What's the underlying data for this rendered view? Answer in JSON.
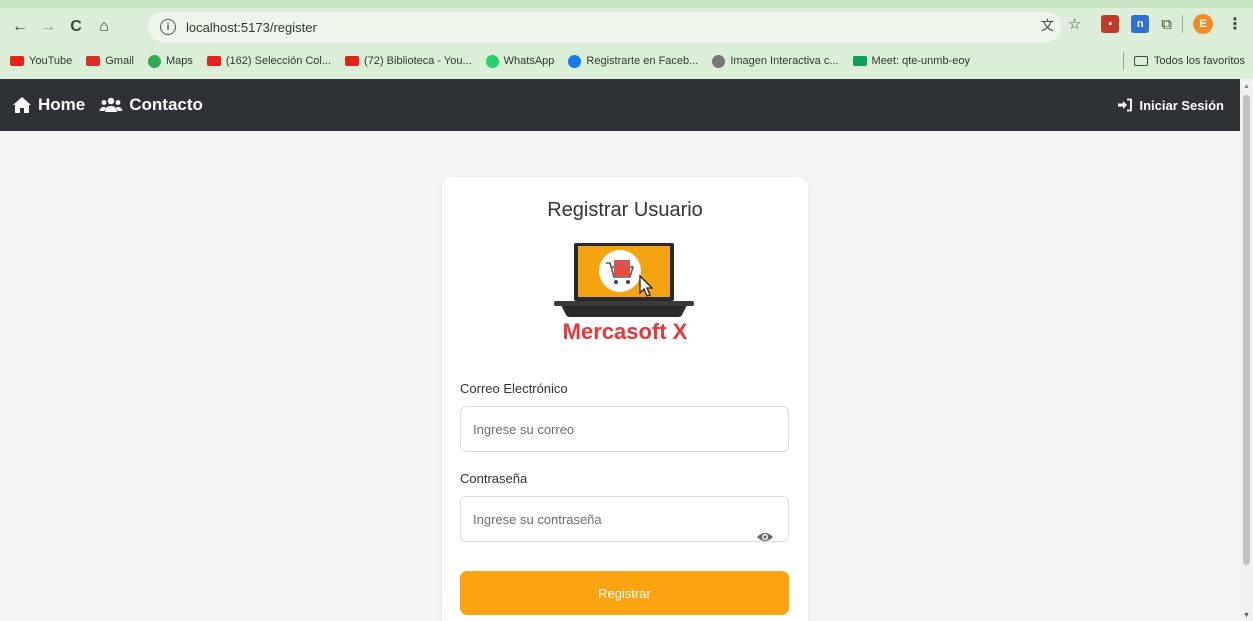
{
  "browser": {
    "url": "localhost:5173/register",
    "profile_initial": "E",
    "bookmarks": [
      {
        "label": "YouTube",
        "color": "#e62117"
      },
      {
        "label": "Gmail",
        "color": "#d93025"
      },
      {
        "label": "Maps",
        "color": "#34a853"
      },
      {
        "label": "(162) Selección Col...",
        "color": "#e62117"
      },
      {
        "label": "(72) Biblioteca - You...",
        "color": "#e62117"
      },
      {
        "label": "WhatsApp",
        "color": "#25d366"
      },
      {
        "label": "Registrarte en Faceb...",
        "color": "#1877f2"
      },
      {
        "label": "Imagen Interactiva c...",
        "color": "#777777"
      },
      {
        "label": "Meet: qte-unmb-eoy",
        "color": "#0f9d58"
      }
    ],
    "all_bookmarks": "Todos los favoritos"
  },
  "navbar": {
    "home": "Home",
    "contact": "Contacto",
    "login": "Iniciar Sesión"
  },
  "form": {
    "title": "Registrar Usuario",
    "brand": "Mercasoft X",
    "email_label": "Correo Electrónico",
    "email_placeholder": "Ingrese su correo",
    "password_label": "Contraseña",
    "password_placeholder": "Ingrese su contraseña",
    "submit": "Registrar"
  },
  "colors": {
    "navbar": "#2e3136",
    "accent": "#fca311",
    "brand": "#e23a3a"
  }
}
